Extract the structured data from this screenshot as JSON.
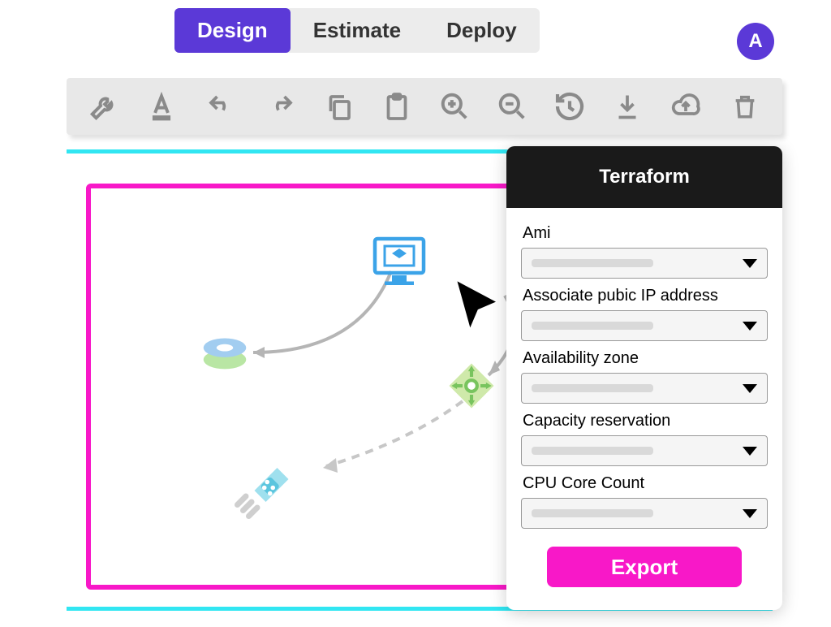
{
  "tabs": [
    "Design",
    "Estimate",
    "Deploy"
  ],
  "active_tab": 0,
  "avatar_initial": "A",
  "colors": {
    "accent": "#5b39d7",
    "magenta": "#f818c8",
    "cyan": "#31e6f2"
  },
  "toolbar": {
    "items": [
      "wrench-icon",
      "text-color-icon",
      "undo-icon",
      "redo-icon",
      "copy-icon",
      "paste-icon",
      "zoom-in-icon",
      "zoom-out-icon",
      "history-icon",
      "download-icon",
      "cloud-upload-icon",
      "trash-icon"
    ]
  },
  "panel": {
    "title": "Terraform",
    "fields": [
      "Ami",
      "Associate pubic IP address",
      "Availability zone",
      "Capacity reservation",
      "CPU Core Count"
    ],
    "export_label": "Export"
  }
}
